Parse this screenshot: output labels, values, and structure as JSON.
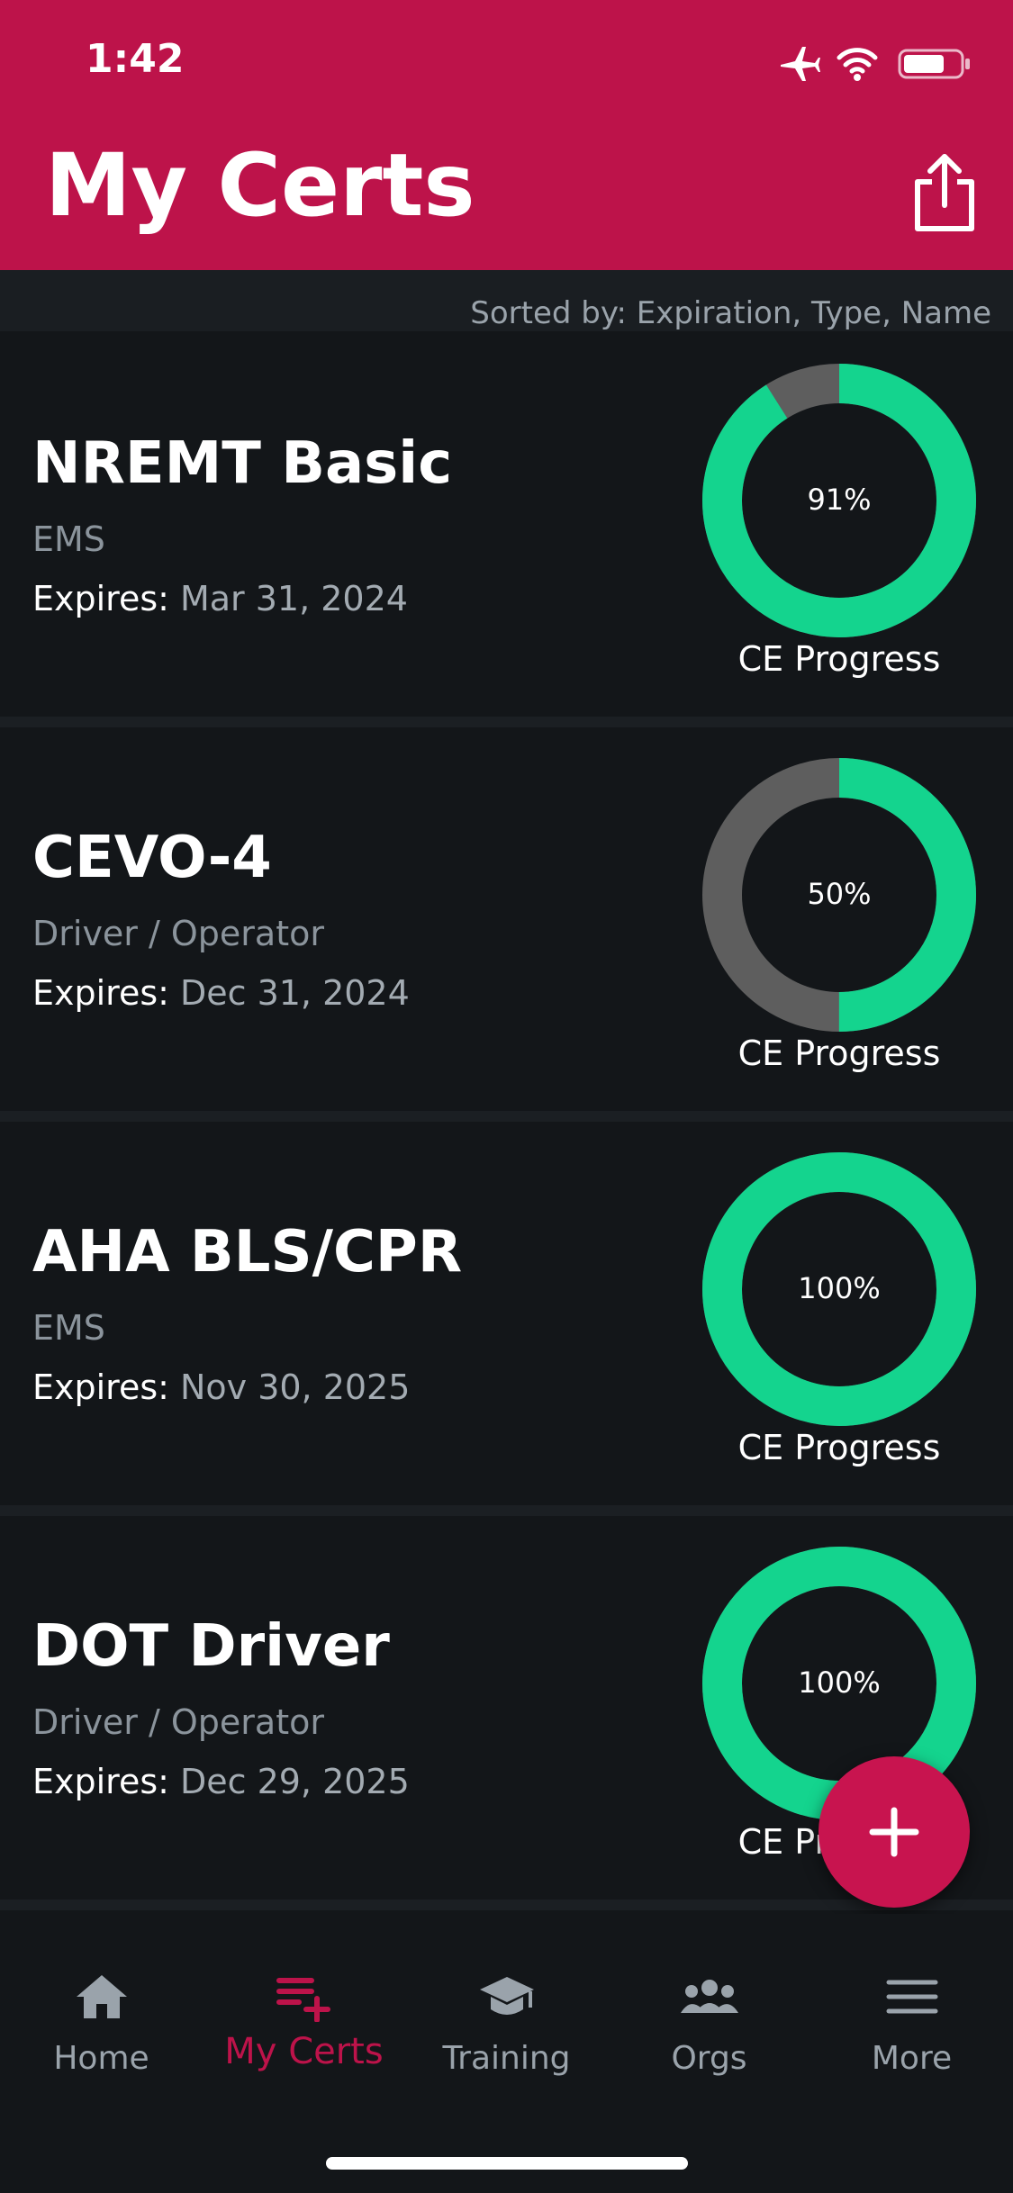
{
  "status_bar": {
    "time": "1:42"
  },
  "header": {
    "title": "My Certs"
  },
  "sort_text": "Sorted by: Expiration, Type, Name",
  "certs": [
    {
      "name": "NREMT Basic",
      "category": "EMS",
      "expires_label": "Expires:",
      "expires_date": "Mar 31, 2024",
      "progress_text": "91%",
      "progress": 0.91,
      "progress_caption": "CE Progress"
    },
    {
      "name": "CEVO-4",
      "category": "Driver / Operator",
      "expires_label": "Expires:",
      "expires_date": "Dec 31, 2024",
      "progress_text": "50%",
      "progress": 0.5,
      "progress_caption": "CE Progress"
    },
    {
      "name": "AHA BLS/CPR",
      "category": "EMS",
      "expires_label": "Expires:",
      "expires_date": "Nov 30, 2025",
      "progress_text": "100%",
      "progress": 1.0,
      "progress_caption": "CE Progress"
    },
    {
      "name": "DOT Driver",
      "category": "Driver / Operator",
      "expires_label": "Expires:",
      "expires_date": "Dec 29, 2025",
      "progress_text": "100%",
      "progress": 1.0,
      "progress_caption": "CE Progress"
    }
  ],
  "fab": {
    "icon": "plus-icon"
  },
  "tabs": [
    {
      "label": "Home",
      "icon": "home-icon",
      "active": false
    },
    {
      "label": "My Certs",
      "icon": "list-add-icon",
      "active": true
    },
    {
      "label": "Training",
      "icon": "graduation-cap-icon",
      "active": false
    },
    {
      "label": "Orgs",
      "icon": "users-icon",
      "active": false
    },
    {
      "label": "More",
      "icon": "menu-icon",
      "active": false
    }
  ],
  "colors": {
    "brand": "#bd134a",
    "progress_fill": "#14d48e",
    "progress_track": "#5e5e5e",
    "background": "#131619"
  }
}
